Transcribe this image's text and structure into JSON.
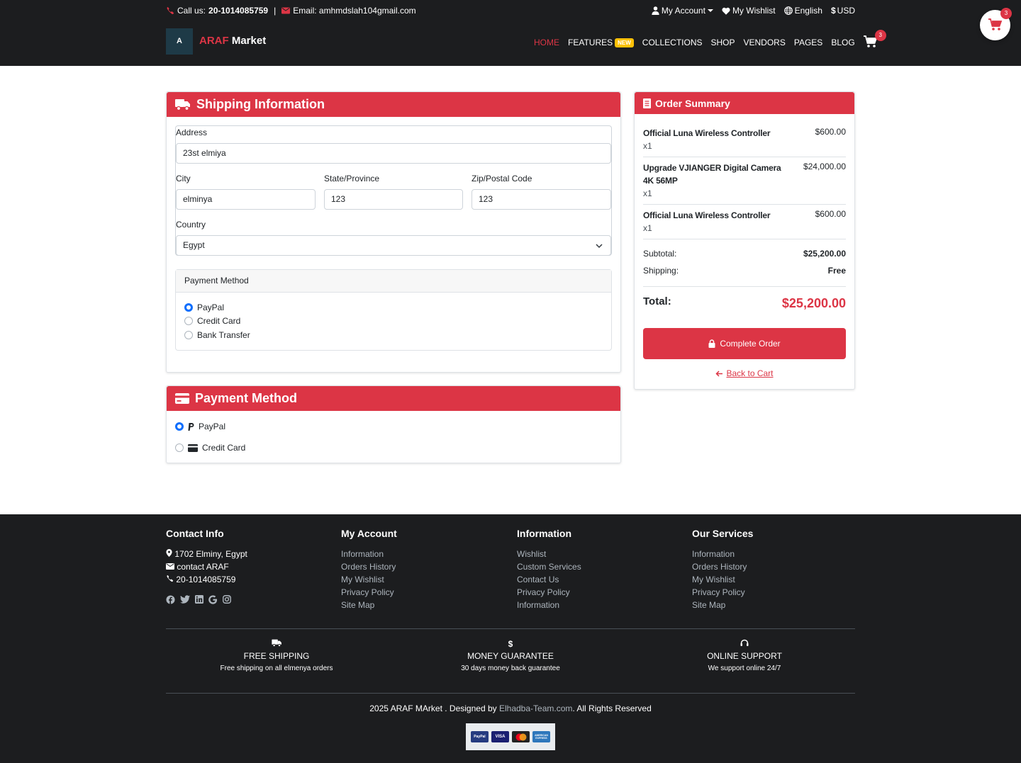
{
  "topbar": {
    "call_label": "Call us:",
    "phone": "20-1014085759",
    "separator": "|",
    "email_label": "Email: amhmdslah104gmail.com",
    "account": "My Account",
    "wishlist": "My Wishlist",
    "language": "English",
    "currency": "USD"
  },
  "brand": {
    "logo_letter": "A",
    "name_red": "ARAF",
    "name_white": "Market"
  },
  "nav": {
    "items": [
      "HOME",
      "FEATURES",
      "COLLECTIONS",
      "SHOP",
      "VENDORS",
      "PAGES",
      "BLOG"
    ],
    "new_badge": "NEW",
    "cart_count": "3"
  },
  "floating_cart": {
    "count": "3"
  },
  "shipping": {
    "title": "Shipping Information",
    "address_label": "Address",
    "address_value": "23st elmiya",
    "city_label": "City",
    "city_value": "elminya",
    "state_label": "State/Province",
    "state_value": "123",
    "zip_label": "Zip/Postal Code",
    "zip_value": "123",
    "country_label": "Country",
    "country_value": "Egypt",
    "payment_method_label": "Payment Method",
    "payment_options": [
      "PayPal",
      "Credit Card",
      "Bank Transfer"
    ],
    "selected_option": "PayPal"
  },
  "payment": {
    "title": "Payment Method",
    "options": [
      "PayPal",
      "Credit Card"
    ],
    "selected_option": "PayPal"
  },
  "order_summary": {
    "title": "Order Summary",
    "items": [
      {
        "name": "Official Luna Wireless Controller",
        "qty": "x1",
        "price": "$600.00"
      },
      {
        "name": "Upgrade VJIANGER Digital Camera 4K 56MP",
        "qty": "x1",
        "price": "$24,000.00"
      },
      {
        "name": "Official Luna Wireless Controller",
        "qty": "x1",
        "price": "$600.00"
      }
    ],
    "subtotal_label": "Subtotal:",
    "subtotal_value": "$25,200.00",
    "shipping_label": "Shipping:",
    "shipping_value": "Free",
    "total_label": "Total:",
    "total_value": "$25,200.00",
    "complete_button": "Complete Order",
    "back_link": "Back to Cart"
  },
  "footer": {
    "contact": {
      "title": "Contact Info",
      "address": "1702 Elminy, Egypt",
      "email": "contact ARAF",
      "phone": "20-1014085759"
    },
    "my_account": {
      "title": "My Account",
      "links": [
        "Information",
        "Orders History",
        "My Wishlist",
        "Privacy Policy",
        "Site Map"
      ]
    },
    "information": {
      "title": "Information",
      "links": [
        "Wishlist",
        "Custom Services",
        "Contact Us",
        "Privacy Policy",
        "Information"
      ]
    },
    "services": {
      "title": "Our Services",
      "links": [
        "Information",
        "Orders History",
        "My Wishlist",
        "Privacy Policy",
        "Site Map"
      ]
    },
    "features": [
      {
        "title": "FREE SHIPPING",
        "subtitle": "Free shipping on all elmenya orders"
      },
      {
        "title": "MONEY GUARANTEE",
        "subtitle": "30 days money back guarantee"
      },
      {
        "title": "ONLINE SUPPORT",
        "subtitle": "We support online 24/7"
      }
    ],
    "copyright_prefix": "2025 ARAF MArket . Designed by",
    "copyright_link": "Elhadba-Team.com",
    "copyright_suffix": ". All Rights Reserved",
    "payment_cards": [
      "PayPal",
      "VISA",
      "",
      "AMERICAN EXPRESS"
    ]
  },
  "colors": {
    "accent": "#dc3545",
    "dark": "#1c1d1f",
    "radio": "#0d6efd",
    "badge": "#ffc107"
  }
}
